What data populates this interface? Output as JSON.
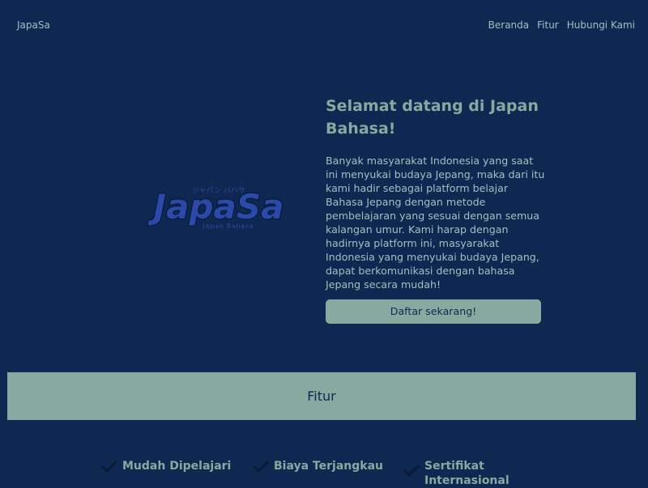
{
  "nav": {
    "brand": "JapaSa",
    "links": [
      "Beranda",
      "Fitur",
      "Hubungi Kami"
    ]
  },
  "logo": {
    "name": "JapaSa",
    "kana": "ジャパン バハサ",
    "subtitle": "Japan Bahasa"
  },
  "hero": {
    "title": "Selamat datang di Japan Bahasa!",
    "description": "Banyak masyarakat Indonesia yang saat ini menyukai budaya Jepang, maka dari itu kami hadir sebagai platform belajar Bahasa Jepang dengan metode pembelajaran yang sesuai dengan semua kalangan umur. Kami harap dengan hadirnya platform ini, masyarakat Indonesia yang menyukai budaya Jepang, dapat berkomunikasi dengan bahasa Jepang secara mudah!",
    "cta_label": "Daftar sekarang!"
  },
  "features": {
    "title": "Fitur",
    "items": [
      "Mudah Dipelajari",
      "Biaya Terjangkau",
      "Sertifikat Internasional"
    ]
  },
  "colors": {
    "background": "#0e2852",
    "accent": "#86aa9f",
    "text_light": "#9cc3bf",
    "logo_fill": "#2a49a8"
  },
  "icons": {
    "feature_check": "check-icon"
  }
}
